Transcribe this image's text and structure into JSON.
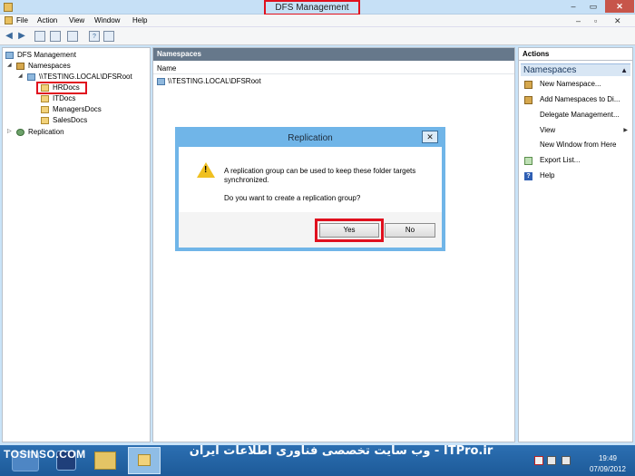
{
  "window": {
    "title": "DFS Management",
    "btn_min": "–",
    "btn_max": "▭",
    "btn_close": "✕"
  },
  "menu": {
    "items": [
      "File",
      "Action",
      "View",
      "Window",
      "Help"
    ],
    "right_min": "–",
    "right_max": "▫",
    "right_close": "✕"
  },
  "toolbar": {
    "back": "◀",
    "forward": "▶",
    "help": "?"
  },
  "tree": {
    "root": "DFS Management",
    "namespaces": "Namespaces",
    "namespace": "\\\\TESTING.LOCAL\\DFSRoot",
    "folders": [
      "HRDocs",
      "ITDocs",
      "ManagersDocs",
      "SalesDocs"
    ],
    "replication": "Replication"
  },
  "center": {
    "header": "Namespaces",
    "column": "Name",
    "row": "\\\\TESTING.LOCAL\\DFSRoot"
  },
  "actions": {
    "header": "Actions",
    "section": "Namespaces",
    "items": [
      "New Namespace...",
      "Add Namespaces to Di...",
      "Delegate Management...",
      "View",
      "New Window from Here",
      "Export List...",
      "Help"
    ]
  },
  "dialog": {
    "title": "Replication",
    "close": "✕",
    "message": "A replication group can be used to keep these folder targets synchronized.",
    "question": "Do you want to create a replication group?",
    "yes": "Yes",
    "no": "No",
    "warning_mark": "!"
  },
  "taskbar": {
    "watermark_left": "TOSINSO.COM",
    "watermark_right": "ITPro.ir - وب سایت تخصصی فناوری اطلاعات ایران",
    "time": "19:49",
    "date": "07/09/2012"
  },
  "colors": {
    "titlebar": "#c6e0f6",
    "highlight": "#e0101e",
    "dialog_border": "#70b5e8",
    "pane_header": "#66788b",
    "taskbar": "#2c6fb2"
  }
}
